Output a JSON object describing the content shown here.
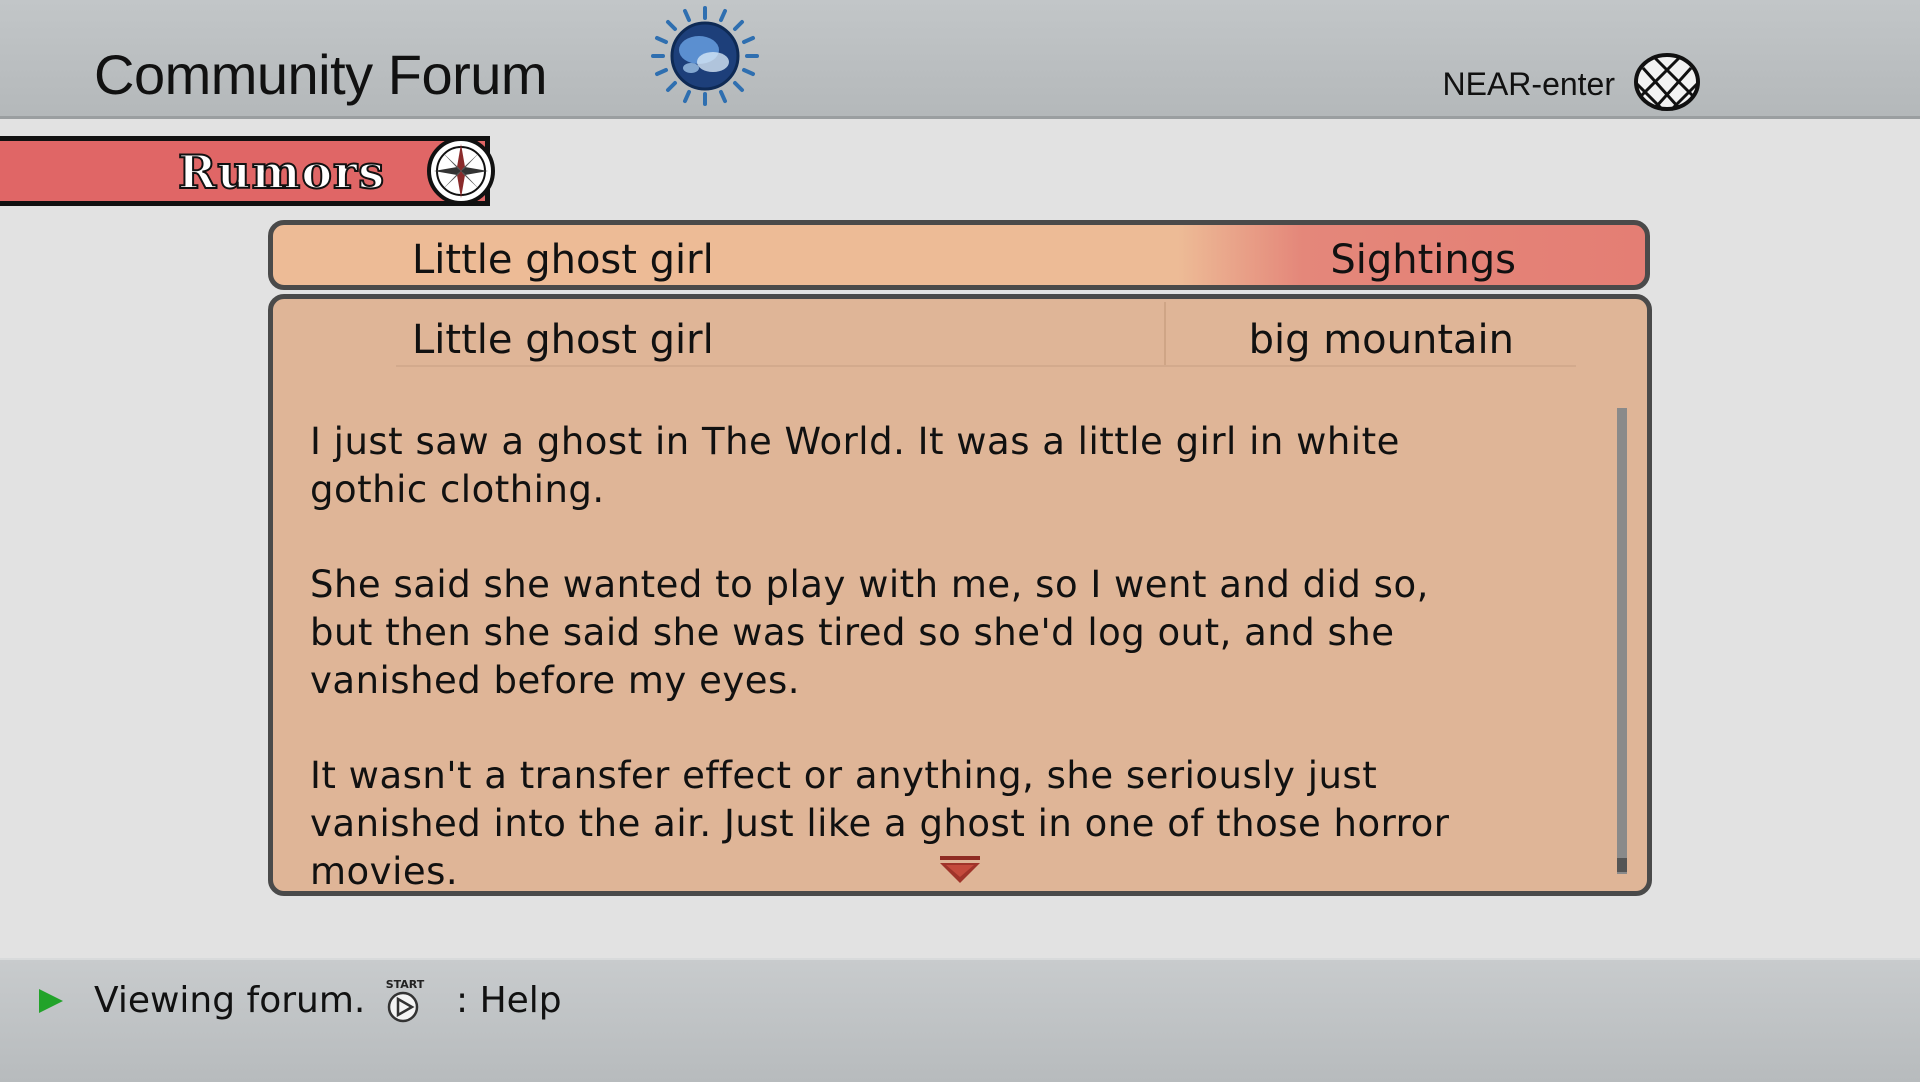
{
  "header": {
    "title": "Community Forum",
    "user": "NEAR-enter",
    "logo_icon": "spinning-globe-icon",
    "network_icon": "wire-globe-icon"
  },
  "category": {
    "label": "Rumors",
    "icon": "compass-rose-icon",
    "color": "#e06666"
  },
  "thread": {
    "title": "Little ghost girl",
    "category": "Sightings"
  },
  "post": {
    "subject": "Little ghost girl",
    "author": "big mountain",
    "paragraphs": [
      "I just saw a ghost in The World. It was a little girl in white gothic clothing.",
      "She said she wanted to play with me, so I went and did so, but then she said she was tired so she'd log out, and she vanished before my eyes.",
      "It wasn't a transfer effect or anything, she seriously just vanished into the air. Just like a ghost in one of those horror movies."
    ],
    "scroll_icon": "scroll-down-arrow-icon"
  },
  "status": {
    "text": "Viewing forum.",
    "help_label": ": Help",
    "button_icon": "start-button-icon",
    "button_label": "START"
  }
}
